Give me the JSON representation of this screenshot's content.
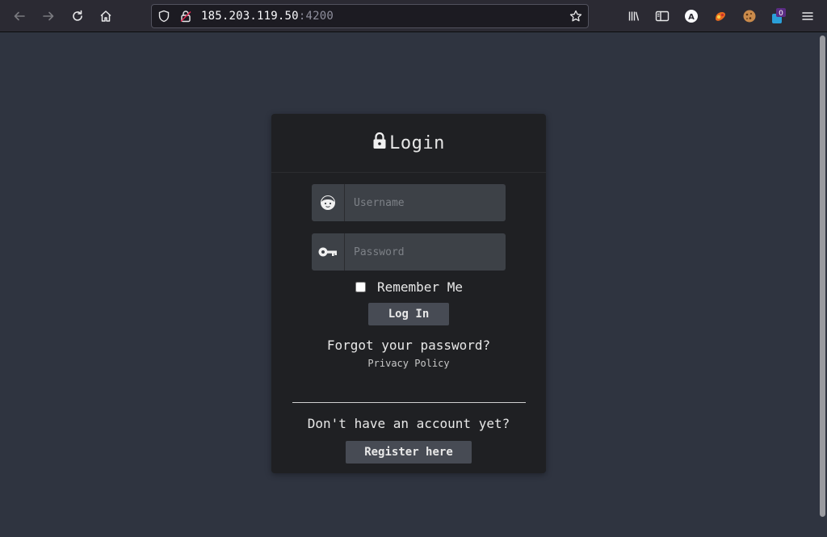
{
  "browser": {
    "url_host": "185.203.119.50",
    "url_port": ":4200",
    "extension_badge_count": "0",
    "account_initial": "A"
  },
  "login": {
    "title": "Login",
    "username_placeholder": "Username",
    "password_placeholder": "Password",
    "remember_label": "Remember Me",
    "login_button": "Log In",
    "forgot_link": "Forgot your password?",
    "privacy_link": "Privacy Policy",
    "no_account_text": "Don't have an account yet?",
    "register_button": "Register here"
  },
  "colors": {
    "page_bg": "#2f3440",
    "card_bg": "#1f2023",
    "field_bg": "#3d4147",
    "button_bg": "#474b54"
  },
  "icons": [
    "back-icon",
    "forward-icon",
    "reload-icon",
    "home-icon",
    "shield-icon",
    "insecure-lock-icon",
    "bookmark-star-icon",
    "library-icon",
    "sidebar-icon",
    "account-icon",
    "extension-icon",
    "cookie-icon",
    "extension-badge-icon",
    "menu-icon",
    "lock-icon",
    "user-face-icon",
    "key-icon"
  ]
}
